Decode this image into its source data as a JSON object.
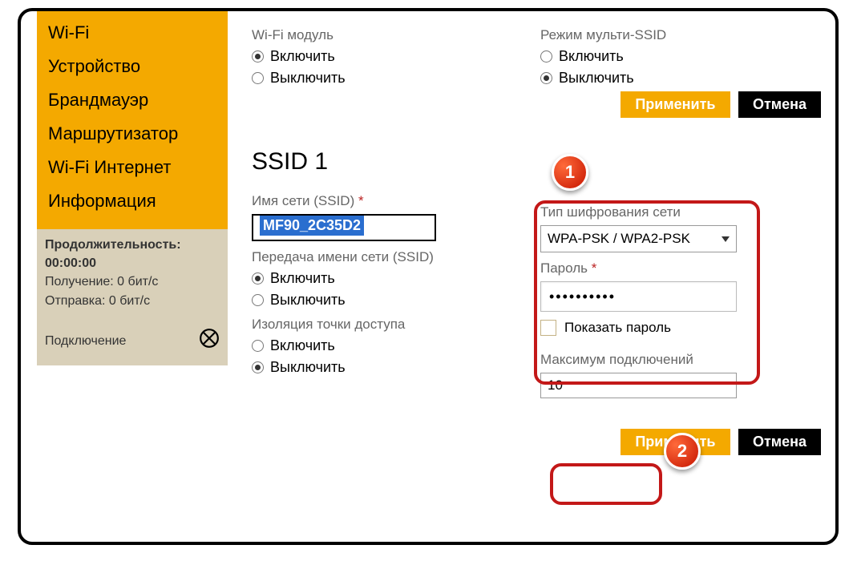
{
  "sidebar": {
    "items": [
      "Wi-Fi",
      "Устройство",
      "Брандмауэр",
      "Маршрутизатор",
      "Wi-Fi  Интернет",
      "Информация"
    ]
  },
  "status": {
    "duration_label": "Продолжительность:",
    "duration_value": "00:00:00",
    "rx": "Получение: 0 бит/с",
    "tx": "Отправка: 0 бит/с",
    "connection": "Подключение"
  },
  "wifi_module": {
    "label": "Wi-Fi модуль",
    "enable": "Включить",
    "disable": "Выключить",
    "selected": "enable"
  },
  "multi_ssid": {
    "label": "Режим мульти-SSID",
    "enable": "Включить",
    "disable": "Выключить",
    "selected": "disable"
  },
  "buttons": {
    "apply": "Применить",
    "cancel": "Отмена"
  },
  "ssid_section": {
    "heading": "SSID 1",
    "name_label": "Имя сети (SSID)",
    "name_value": "MF90_2C35D2",
    "broadcast_label": "Передача имени сети (SSID)",
    "broadcast_enable": "Включить",
    "broadcast_disable": "Выключить",
    "broadcast_selected": "enable",
    "isolation_label": "Изоляция точки доступа",
    "isolation_enable": "Включить",
    "isolation_disable": "Выключить",
    "isolation_selected": "disable"
  },
  "security": {
    "enc_label": "Тип шифрования сети",
    "enc_value": "WPA-PSK / WPA2-PSK",
    "pwd_label": "Пароль",
    "pwd_mask": "••••••••••",
    "show_pwd": "Показать пароль"
  },
  "max_conn": {
    "label": "Максимум подключений",
    "value": "10"
  },
  "badges": {
    "one": "1",
    "two": "2"
  }
}
